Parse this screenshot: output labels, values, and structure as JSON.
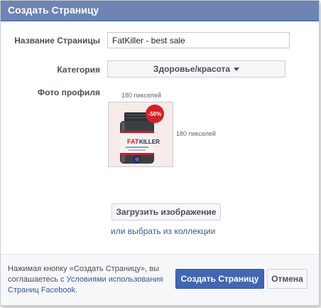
{
  "dialog": {
    "title": "Создать Страницу"
  },
  "form": {
    "name_label": "Название Страницы",
    "name_value": "FatKiller - best sale",
    "category_label": "Категория",
    "category_value": "Здоровье/красота",
    "photo_label": "Фото профиля",
    "photo_width_hint": "180 пикселей",
    "photo_height_hint": "180 пикселей",
    "product": {
      "brand_line1_a": "FAT",
      "brand_line1_b": "KILLER",
      "discount_badge": "-50%"
    },
    "upload_button": "Загрузить изображение",
    "collection_link": "или выбрать из коллекции"
  },
  "footer": {
    "terms_prefix": "Нажимая кнопку «Создать Страницу», вы соглашаетесь с ",
    "terms_link": "Условиями использования Страниц Facebook",
    "terms_suffix": ".",
    "create_button": "Создать Страницу",
    "cancel_button": "Отмена"
  },
  "colors": {
    "header": "#6d84b4",
    "primary_button": "#4267b2",
    "link": "#3b5998",
    "badge": "#d0232a"
  },
  "icons": {
    "dropdown": "chevron-down-icon",
    "product": "supplement-jar-image"
  }
}
